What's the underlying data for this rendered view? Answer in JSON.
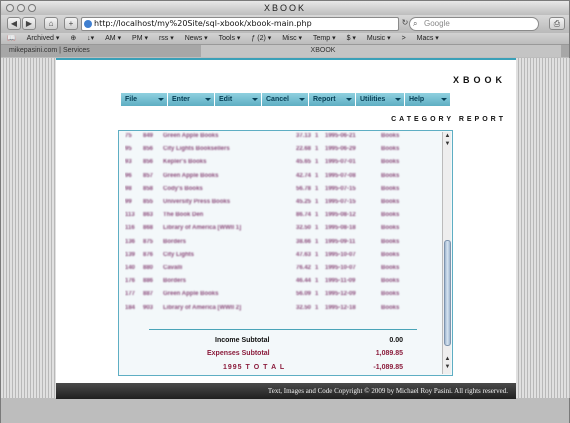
{
  "window": {
    "title": "XBOOK"
  },
  "toolbar": {
    "back": "◀",
    "forward": "▶",
    "home": "⌂",
    "add": "+",
    "url": "http://localhost/my%20Site/sql-xbook/xbook-main.php",
    "search_placeholder": "Google"
  },
  "bookmarks": [
    "Archived ▾",
    "⊕",
    "↓▾",
    "AM ▾",
    "PM ▾",
    "rss ▾",
    "News ▾",
    "Tools ▾",
    "ƒ (2) ▾",
    "Misc ▾",
    "Temp ▾",
    "$ ▾",
    "Music ▾",
    ">",
    "Macs ▾"
  ],
  "tabs": [
    "mikepasini.com | Services",
    "XBOOK"
  ],
  "app": {
    "logo": "XBOOK",
    "menus": [
      "File",
      "Enter",
      "Edit",
      "Cancel",
      "Report",
      "Utilities",
      "Help"
    ],
    "report_title": "CATEGORY REPORT"
  },
  "report": {
    "rows": [
      [
        "75",
        "849",
        "Green Apple Books",
        "37.13",
        "1",
        "1995-06-21",
        "Books"
      ],
      [
        "95",
        "856",
        "City Lights Booksellers",
        "22.68",
        "1",
        "1995-06-29",
        "Books"
      ],
      [
        "93",
        "856",
        "Kepler's Books",
        "45.65",
        "1",
        "1995-07-01",
        "Books"
      ],
      [
        "96",
        "857",
        "Green Apple Books",
        "42.74",
        "1",
        "1995-07-08",
        "Books"
      ],
      [
        "98",
        "858",
        "Cody's Books",
        "56.78",
        "1",
        "1995-07-15",
        "Books"
      ],
      [
        "99",
        "855",
        "University Press Books",
        "45.25",
        "1",
        "1995-07-15",
        "Books"
      ],
      [
        "113",
        "863",
        "The Book Den",
        "86.74",
        "1",
        "1995-08-12",
        "Books"
      ],
      [
        "116",
        "868",
        "Library of America [WWII 1]",
        "32.50",
        "1",
        "1995-08-18",
        "Books"
      ],
      [
        "136",
        "875",
        "Borders",
        "38.66",
        "1",
        "1995-09-11",
        "Books"
      ],
      [
        "139",
        "876",
        "City Lights",
        "47.63",
        "1",
        "1995-10-07",
        "Books"
      ],
      [
        "140",
        "880",
        "Cavalli",
        "76.42",
        "1",
        "1995-10-07",
        "Books"
      ],
      [
        "176",
        "886",
        "Borders",
        "46.44",
        "1",
        "1995-11-09",
        "Books"
      ],
      [
        "177",
        "887",
        "Green Apple Books",
        "56.09",
        "1",
        "1995-12-09",
        "Books"
      ],
      [
        "184",
        "903",
        "Library of America [WWII 2]",
        "32.50",
        "1",
        "1995-12-18",
        "Books"
      ]
    ],
    "income_label": "Income Subtotal",
    "income_value": "0.00",
    "expenses_label": "Expenses Subtotal",
    "expenses_value": "1,089.85",
    "total_label": "1995  T O T A L",
    "total_value": "-1,089.85"
  },
  "footer": "Text, Images and Code Copyright © 2009 by Michael Roy Pasini. All rights reserved.",
  "colors": {
    "accent": "#5eaec3",
    "expense": "#8b1c3c",
    "row_text": "#8a4a7a"
  }
}
